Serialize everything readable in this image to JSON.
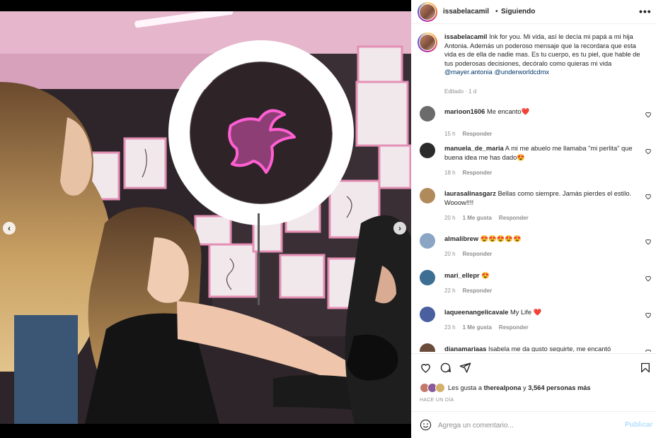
{
  "post": {
    "username": "issabelacamil",
    "separator": "•",
    "follow_status": "Siguiendo",
    "more": "•••",
    "caption_user": "issabelacamil",
    "caption_text": "Ink for you. Mi vida, así le decía mi papá a mi hija Antonia. Además un poderoso mensaje que la recordara que esta vida es de ella de nadie mas. Es tu cuerpo, es tu piel, que hable de tus poderosas decisiones, decóralo como quieras mi vida",
    "mention_1": "@mayer.antonia",
    "mention_2": "@underworldcdmx",
    "edited": "Editado · 1 d"
  },
  "photo": {
    "prev": "‹",
    "next": "›",
    "carousel_count": 3,
    "carousel_active": 1
  },
  "comments": [
    {
      "user": "marioon1606",
      "text": "Me encanto❤️",
      "time": "15 h",
      "likes": "",
      "reply": "Responder",
      "avatar_color": "#6b6b6b"
    },
    {
      "user": "manuela_de_maria",
      "text": "A mi me abuelo me llamaba \"mi perlita\" que buena idea me has dado😍",
      "time": "18 h",
      "likes": "",
      "reply": "Responder",
      "avatar_color": "#2b2b2b"
    },
    {
      "user": "laurasalinasgarz",
      "text": "Bellas como siempre. Jamás pierdes el estilo. Wooow!!!!",
      "time": "20 h",
      "likes": "1 Me gusta",
      "reply": "Responder",
      "avatar_color": "#b08a5a"
    },
    {
      "user": "almalibrew",
      "text": "😍😍😍😍😍",
      "time": "20 h",
      "likes": "",
      "reply": "Responder",
      "avatar_color": "#8aa6c4"
    },
    {
      "user": "mari_ellepr",
      "text": "😍",
      "time": "22 h",
      "likes": "",
      "reply": "Responder",
      "avatar_color": "#3d6e94"
    },
    {
      "user": "laqueenangelicavale",
      "text": "My Life ❤️",
      "time": "23 h",
      "likes": "1 Me gusta",
      "reply": "Responder",
      "avatar_color": "#4a5fa0"
    },
    {
      "user": "dianamariaas",
      "text": "Isabela me da gusto seguirte, me encantó",
      "time": "",
      "likes": "",
      "reply": "",
      "avatar_color": "#6a4a3a"
    }
  ],
  "likes": {
    "prefix": "Les gusta a",
    "user": "therealpona",
    "middle": "y",
    "count": "3,564 personas más"
  },
  "time_ago": "HACE UN DÍA",
  "add_comment": {
    "placeholder": "Agrega un comentario...",
    "publish_label": "Publicar"
  },
  "colors": {
    "link": "#00376b",
    "secondary_text": "#8e8e8e",
    "publish_disabled": "#b2dffc",
    "carousel_active": "#3897f0"
  },
  "icons": [
    "emoji-icon",
    "heart-icon",
    "comment-icon",
    "share-icon",
    "bookmark-icon",
    "more-icon",
    "chevron-left-icon",
    "chevron-right-icon"
  ]
}
